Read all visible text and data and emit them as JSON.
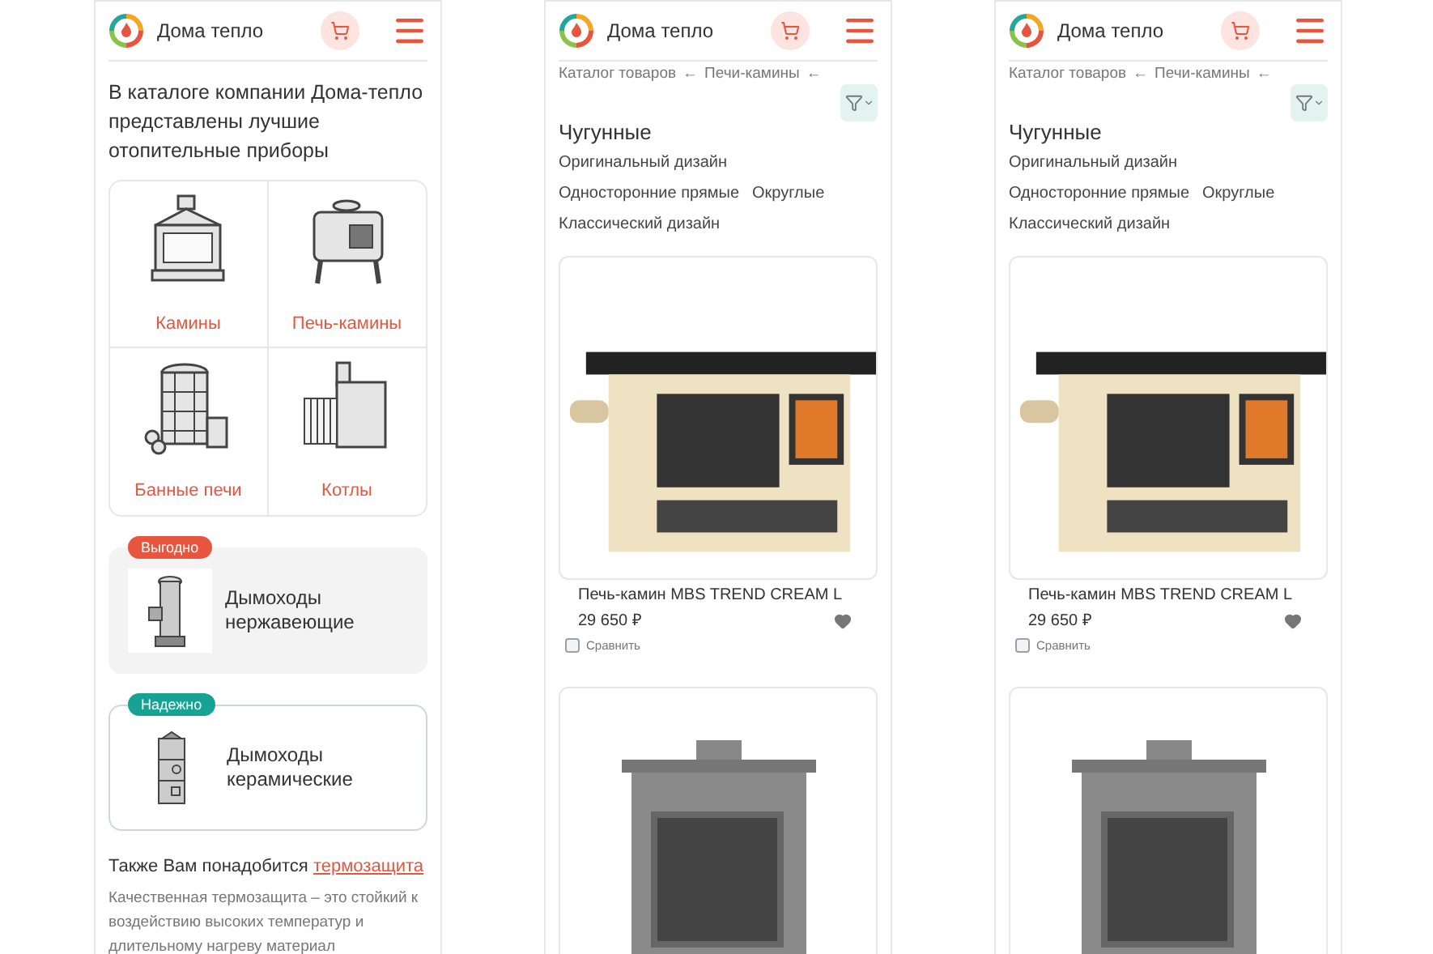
{
  "screens": [
    {
      "kind": "home",
      "header": {
        "brand": "Дома тепло"
      },
      "intro": "В каталоге компании Дома-тепло представлены лучшие отопительные приборы",
      "categories": [
        {
          "kind": "fireplace",
          "label": "Камины"
        },
        {
          "kind": "stove",
          "label": "Печь-камины"
        },
        {
          "kind": "sauna",
          "label": "Банные печи"
        },
        {
          "kind": "boiler",
          "label": "Котлы"
        }
      ],
      "promos": [
        {
          "kind": "steel",
          "badge": "Выгодно",
          "color": "#e8553e",
          "title": "Дымоходы нержавеющие",
          "highlighted": true
        },
        {
          "kind": "ceramic",
          "badge": "Надежно",
          "color": "#16a394",
          "title": "Дымоходы керамические",
          "highlighted": false
        }
      ],
      "also": {
        "text": "Также Вам понадобится",
        "link": "термозащита"
      },
      "description": "Качественная термозащита – это стойкий к воздействию высоких температур и длительному нагреву материал"
    },
    {
      "kind": "catalog",
      "header": {
        "brand": "Дома тепло"
      },
      "breadcrumbs": [
        {
          "label": "Каталог товаров",
          "separator": "←"
        },
        {
          "label": "Печи-камины",
          "separator": "←"
        }
      ],
      "title": "Чугунные",
      "tag_rows": [
        [
          "Оригинальный дизайн"
        ],
        [
          "Односторонние прямые",
          "Округлые"
        ],
        [
          "Классический дизайн"
        ]
      ],
      "products": [
        {
          "kind": "cream",
          "name": "Печь-камин MBS TREND CREAM L",
          "price": "29 650 ₽",
          "compare": {
            "label": "Сравнить",
            "checked": false
          }
        },
        {
          "kind": "cast"
        }
      ]
    },
    {
      "kind": "catalog",
      "header": {
        "brand": "Дома тепло"
      },
      "breadcrumbs": [
        {
          "label": "Каталог товаров",
          "separator": "←"
        },
        {
          "label": "Печи-камины",
          "separator": "←"
        }
      ],
      "title": "Чугунные",
      "tag_rows": [
        [
          "Оригинальный дизайн"
        ],
        [
          "Односторонние прямые",
          "Округлые"
        ],
        [
          "Классический дизайн"
        ]
      ],
      "products": [
        {
          "kind": "cream",
          "name": "Печь-камин MBS TREND CREAM L",
          "price": "29 650 ₽",
          "compare": {
            "label": "Сравнить",
            "checked": false
          }
        },
        {
          "kind": "cast"
        }
      ]
    }
  ]
}
